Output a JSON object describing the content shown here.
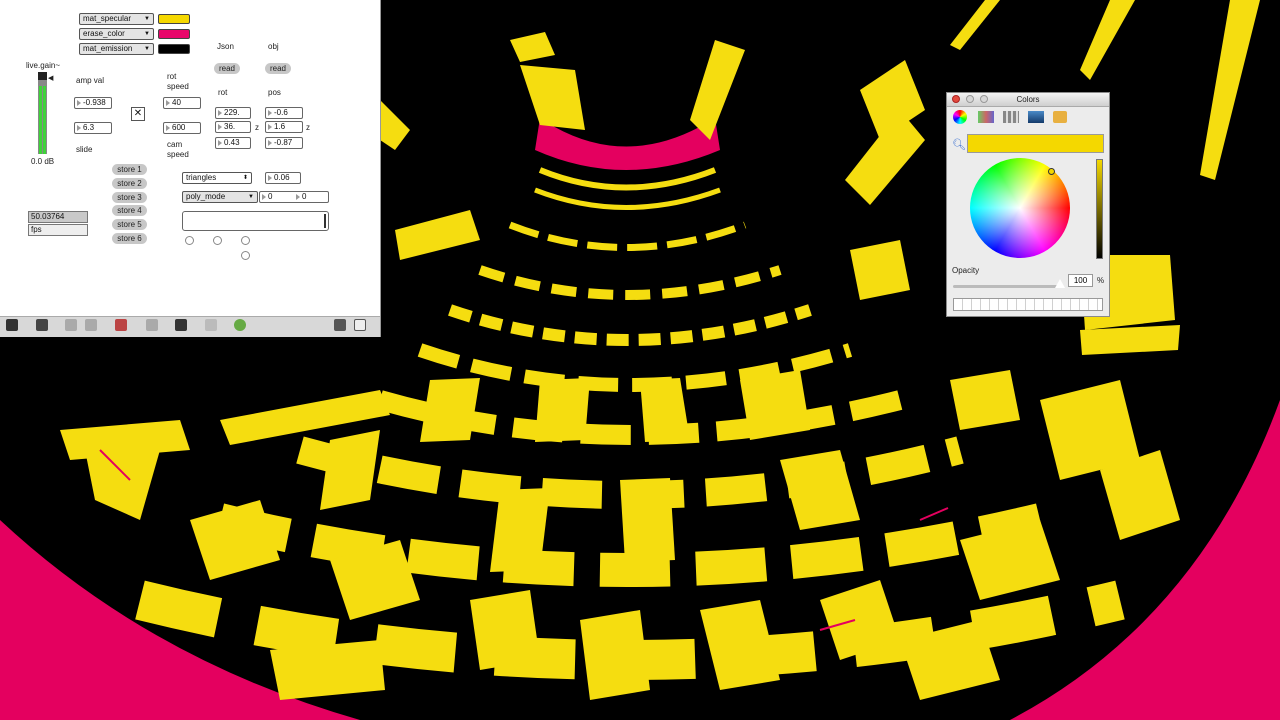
{
  "patcher": {
    "menus": [
      {
        "label": "mat_specular",
        "color": "#f5d800"
      },
      {
        "label": "erase_color",
        "color": "#e8066a"
      },
      {
        "label": "mat_emission",
        "color": "#000000"
      }
    ],
    "gain_label": "live.gain~",
    "gain_db": "0.0 dB",
    "amp_val_label": "amp val",
    "amp_val": "-0.938",
    "slide_val": "6.3",
    "slide_label": "slide",
    "rot_speed_label": "rot speed",
    "rot_speed_val": "40",
    "cam_speed_val": "600",
    "cam_speed_label": "cam speed",
    "json_label": "Json",
    "obj_label": "obj",
    "read_json": "read",
    "read_obj": "read",
    "rot_label": "rot",
    "pos_label": "pos",
    "rot_vals": [
      "229.",
      "36.",
      "0.43"
    ],
    "pos_vals": [
      "-0.6",
      "1.6",
      "-0.87"
    ],
    "z_label": "z",
    "stores": [
      "store 1",
      "store 2",
      "store 3",
      "store 4",
      "store 5",
      "store 6"
    ],
    "fps_value": "50.03764",
    "fps_label": "fps",
    "draw_mode": "triangles",
    "draw_val": "0.06",
    "poly_mode": "poly_mode",
    "poly_vals": [
      "0",
      "0"
    ]
  },
  "colors_panel": {
    "title": "Colors",
    "selected_color": "#f4d800",
    "opacity_label": "Opacity",
    "opacity_value": "100",
    "percent": "%"
  },
  "scene_colors": {
    "yellow": "#f5dd10",
    "magenta": "#e4005f",
    "background": "#000000"
  }
}
